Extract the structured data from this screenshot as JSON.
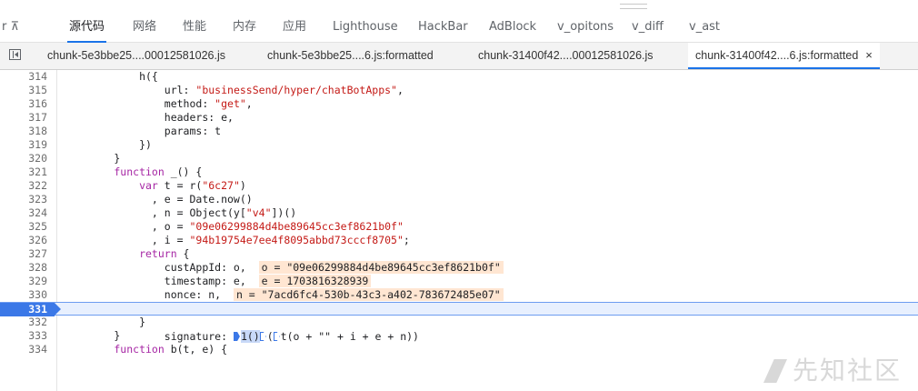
{
  "devtools": {
    "panel_tabs": [
      {
        "label": "r ⊼"
      },
      {
        "label": "源代码"
      },
      {
        "label": "网络"
      },
      {
        "label": "性能"
      },
      {
        "label": "内存"
      },
      {
        "label": "应用"
      },
      {
        "label": "Lighthouse"
      },
      {
        "label": "HackBar"
      },
      {
        "label": "AdBlock"
      },
      {
        "label": "v_opitons"
      },
      {
        "label": "v_diff"
      },
      {
        "label": "v_ast"
      }
    ],
    "active_panel": "源代码",
    "file_tabs": [
      {
        "label": "chunk-5e3bbe25....00012581026.js"
      },
      {
        "label": "chunk-5e3bbe25....6.js:formatted"
      },
      {
        "label": "chunk-31400f42....00012581026.js"
      },
      {
        "label": "chunk-31400f42....6.js:formatted",
        "close": "×"
      }
    ],
    "active_file": "chunk-31400f42....6.js:formatted"
  },
  "editor": {
    "current_line": "331",
    "lines": [
      {
        "n": "314",
        "text": "            h({"
      },
      {
        "n": "315",
        "text": "                url: ",
        "str": "\"businessSend/hyper/chatBotApps\"",
        "tail": ","
      },
      {
        "n": "316",
        "text": "                method: ",
        "str": "\"get\"",
        "tail": ","
      },
      {
        "n": "317",
        "text": "                headers: e,"
      },
      {
        "n": "318",
        "text": "                params: t"
      },
      {
        "n": "319",
        "text": "            })"
      },
      {
        "n": "320",
        "text": "        }"
      },
      {
        "n": "321",
        "kw": "        function",
        "text": " _() {"
      },
      {
        "n": "322",
        "kw": "            var",
        "text": " t = r(",
        "str": "\"6c27\"",
        "tail": ")"
      },
      {
        "n": "323",
        "text": "              , e = Date.now()"
      },
      {
        "n": "324",
        "text": "              , n = Object(y[",
        "str": "\"v4\"",
        "tail": "])()"
      },
      {
        "n": "325",
        "text": "              , o = ",
        "str": "\"09e06299884d4be89645cc3ef8621b0f\""
      },
      {
        "n": "326",
        "text": "              , i = ",
        "str": "\"94b19754e7ee4f8095abbd73cccf8705\"",
        "tail": ";"
      },
      {
        "n": "327",
        "kw": "            return",
        "text": " {"
      },
      {
        "n": "328",
        "text": "                custAppId: o,  ",
        "inline": "o = \"09e06299884d4be89645cc3ef8621b0f\""
      },
      {
        "n": "329",
        "text": "                timestamp: e,  ",
        "inline": "e = 1703816328939"
      },
      {
        "n": "330",
        "text": "                nonce: n,  ",
        "inline": "n = \"7acd6fc4-530b-43c3-a402-783672485e07\""
      },
      {
        "n": "331",
        "text": "                signature: ",
        "tail": "1()",
        "tail2": "(",
        "tail3": "t(o + \"\" + i + e + n))"
      },
      {
        "n": "332",
        "text": "            }"
      },
      {
        "n": "333",
        "text": "        }"
      },
      {
        "n": "334",
        "kw": "        function",
        "text": " b(t, e) {"
      }
    ]
  },
  "watermark": {
    "text": "先知社区"
  },
  "colors": {
    "accent": "#1a73e8",
    "keyword": "#a626a4",
    "string": "#c41a16",
    "inline_value_bg": "#ffe6d2",
    "breakpoint": "#3b78e7"
  }
}
